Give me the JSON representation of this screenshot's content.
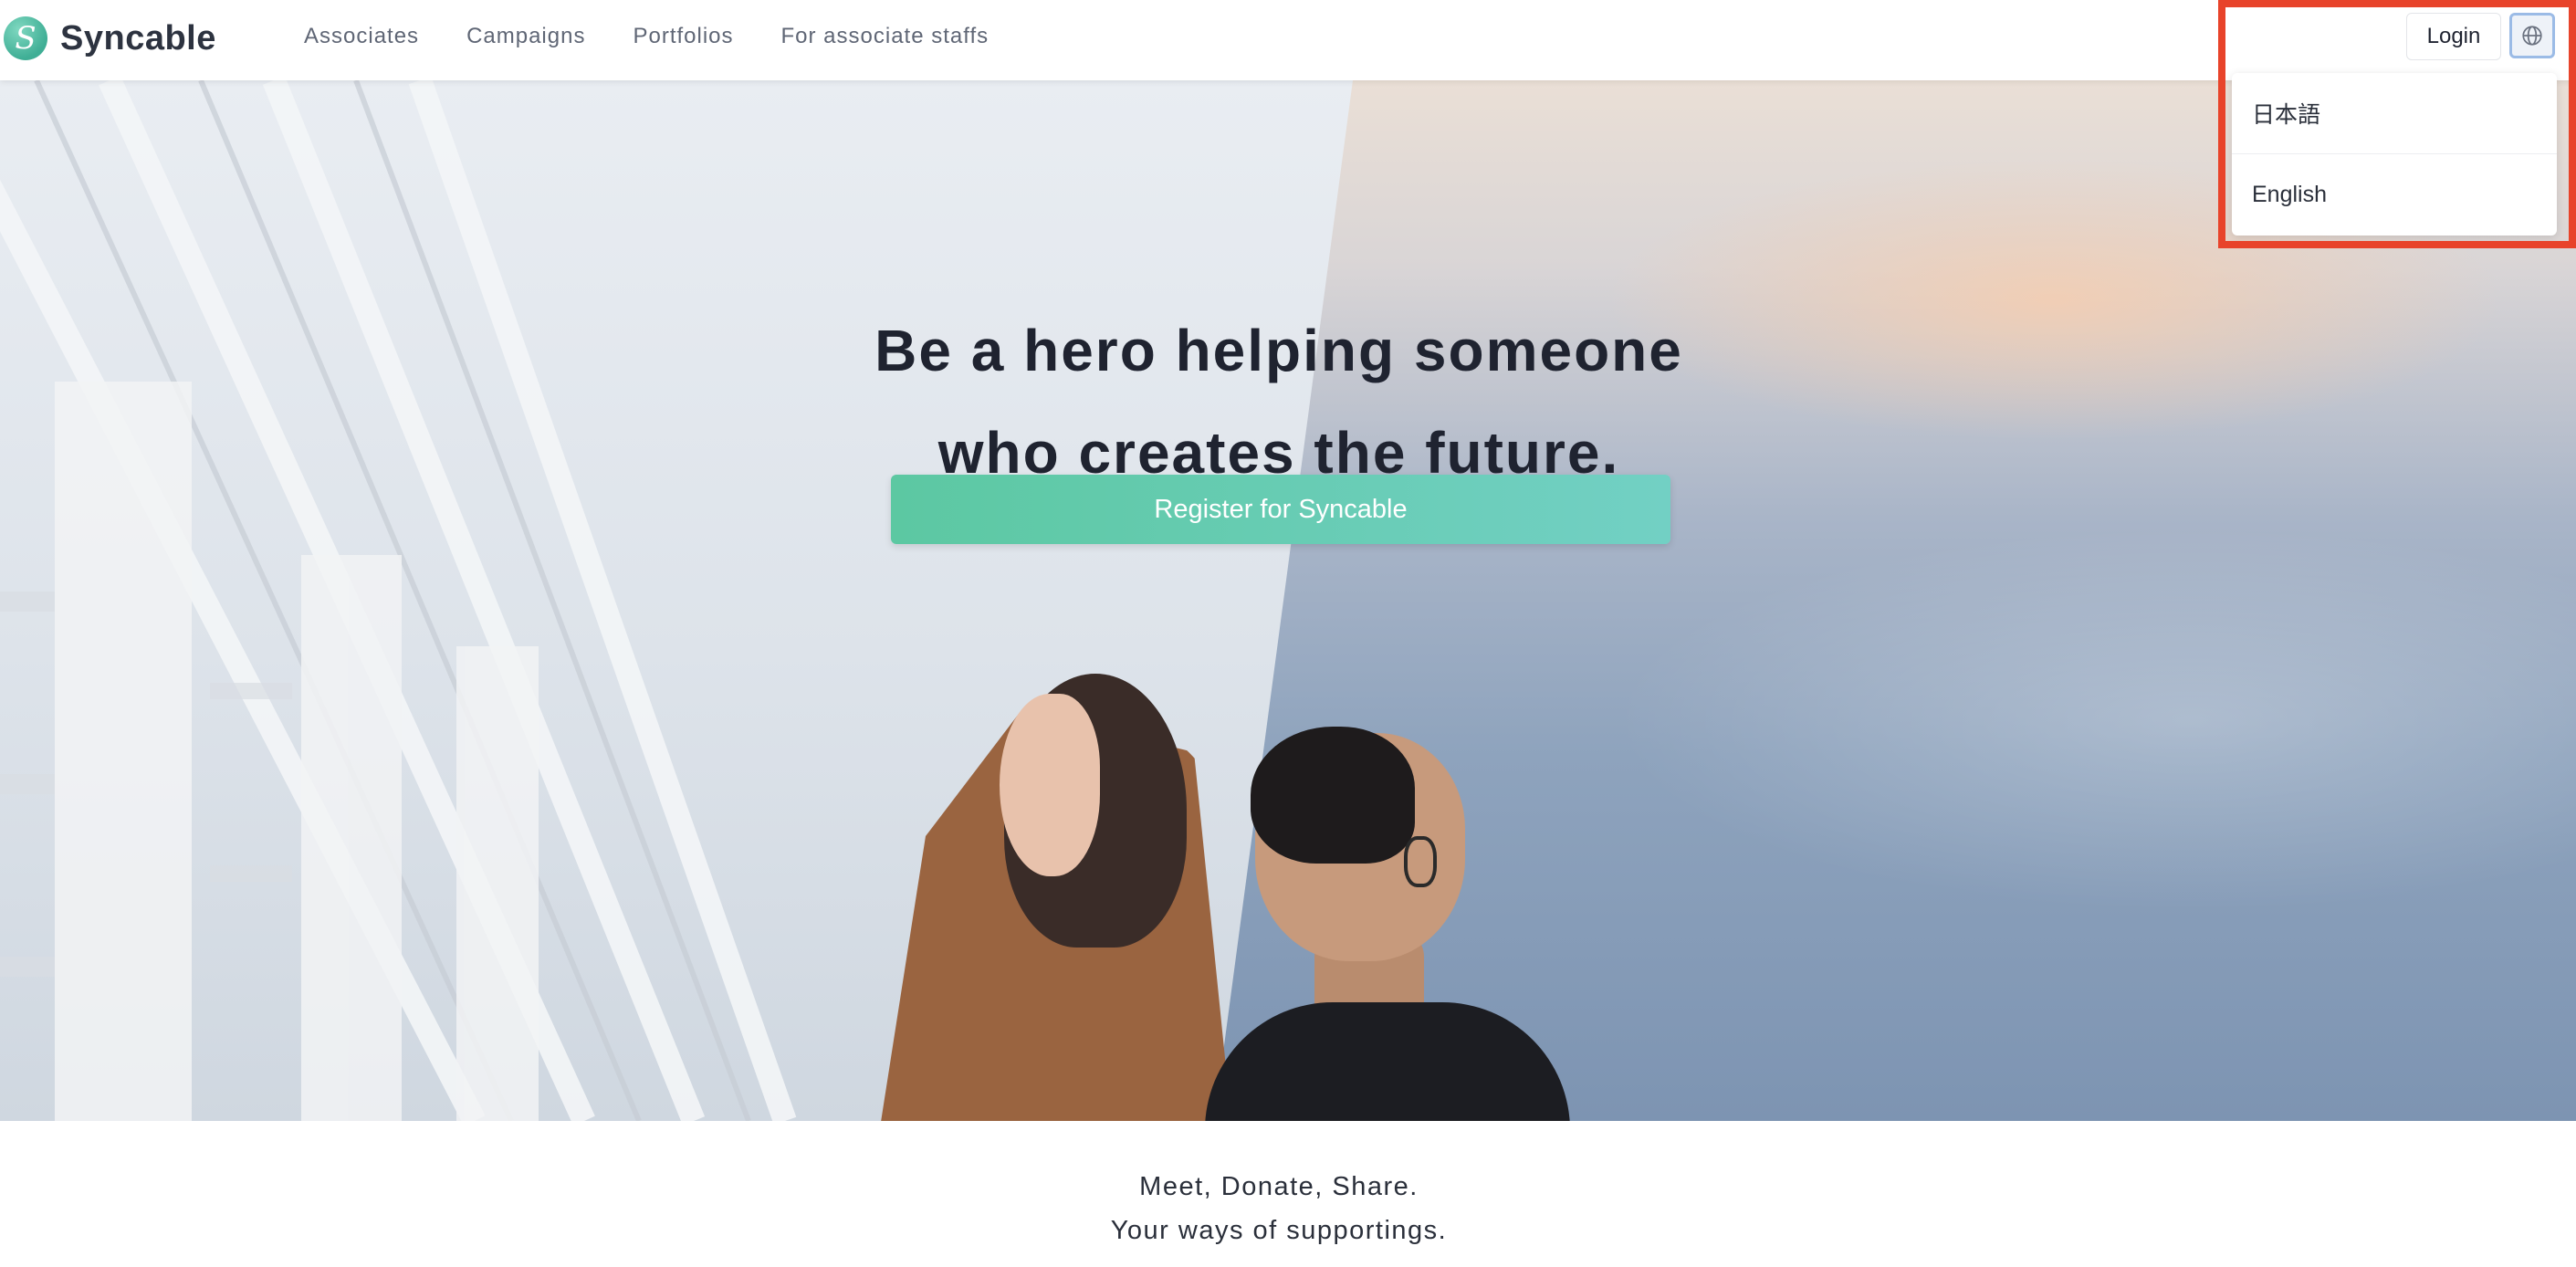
{
  "brand": {
    "name": "Syncable",
    "logo_glyph": "S"
  },
  "nav": {
    "items": [
      {
        "label": "Associates"
      },
      {
        "label": "Campaigns"
      },
      {
        "label": "Portfolios"
      },
      {
        "label": "For associate staffs"
      }
    ]
  },
  "header": {
    "login_label": "Login",
    "language_icon": "globe-icon"
  },
  "language_menu": {
    "open": true,
    "options": [
      {
        "label": "日本語"
      },
      {
        "label": "English"
      }
    ]
  },
  "hero": {
    "title_line1": "Be a hero helping someone",
    "title_line2": "who creates the future.",
    "cta_label": "Register for Syncable"
  },
  "tagline": {
    "line1": "Meet, Donate, Share.",
    "line2": "Your ways of supportings."
  },
  "colors": {
    "accent": "#5cc8a2",
    "highlight": "#e8432a",
    "text": "#1f2330"
  }
}
